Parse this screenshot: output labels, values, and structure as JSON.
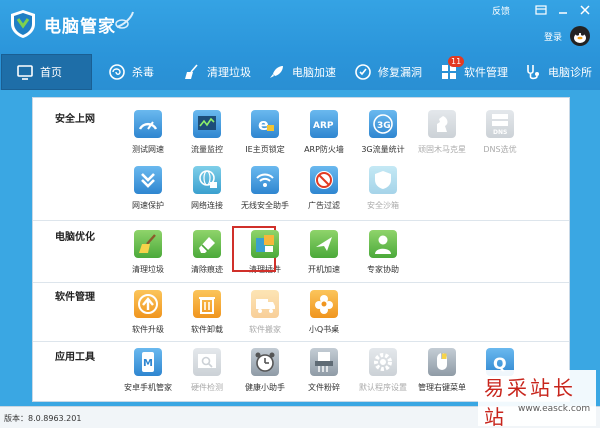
{
  "window": {
    "title": "电脑管家",
    "feedback": "反馈",
    "login": "登录"
  },
  "nav": [
    {
      "label": "首页",
      "icon": "monitor-icon",
      "active": true
    },
    {
      "label": "杀毒",
      "icon": "shield-swirl-icon"
    },
    {
      "label": "清理垃圾",
      "icon": "broom-icon"
    },
    {
      "label": "电脑加速",
      "icon": "rocket-icon"
    },
    {
      "label": "修复漏洞",
      "icon": "patch-icon"
    },
    {
      "label": "软件管理",
      "icon": "app-grid-icon",
      "badge": "11"
    },
    {
      "label": "电脑诊所",
      "icon": "stethoscope-icon"
    }
  ],
  "sections": {
    "security": {
      "title": "安全上网",
      "tools": [
        {
          "label": "测试网速",
          "icon": "speed-test-icon"
        },
        {
          "label": "流量监控",
          "icon": "traffic-monitor-icon"
        },
        {
          "label": "IE主页锁定",
          "icon": "ie-lock-icon"
        },
        {
          "label": "ARP防火墙",
          "icon": "arp-firewall-icon",
          "text": "ARP"
        },
        {
          "label": "3G流量统计",
          "icon": "3g-stats-icon",
          "text": "3G"
        },
        {
          "label": "顽固木马克星",
          "icon": "trojan-killer-icon"
        },
        {
          "label": "DNS选优",
          "icon": "dns-icon",
          "text": "DNS"
        },
        {
          "label": "网速保护",
          "icon": "speed-protect-icon"
        },
        {
          "label": "网络连接",
          "icon": "network-connect-icon"
        },
        {
          "label": "无线安全助手",
          "icon": "wifi-icon"
        },
        {
          "label": "广告过滤",
          "icon": "ad-filter-icon"
        },
        {
          "label": "安全沙箱",
          "icon": "sandbox-icon"
        }
      ]
    },
    "optimize": {
      "title": "电脑优化",
      "tools": [
        {
          "label": "清理垃圾",
          "icon": "broom-icon"
        },
        {
          "label": "清除痕迹",
          "icon": "eraser-icon"
        },
        {
          "label": "清理插件",
          "icon": "plugin-clean-icon"
        },
        {
          "label": "开机加速",
          "icon": "boot-speed-icon"
        },
        {
          "label": "专家协助",
          "icon": "expert-icon"
        }
      ]
    },
    "software": {
      "title": "软件管理",
      "tools": [
        {
          "label": "软件升级",
          "icon": "upgrade-icon"
        },
        {
          "label": "软件卸载",
          "icon": "uninstall-icon"
        },
        {
          "label": "软件搬家",
          "icon": "move-software-icon"
        },
        {
          "label": "小Q书桌",
          "icon": "q-desk-icon"
        }
      ]
    },
    "apps": {
      "title": "应用工具",
      "tools": [
        {
          "label": "安卓手机管家",
          "icon": "android-manager-icon",
          "text": "M"
        },
        {
          "label": "硬件检测",
          "icon": "hardware-check-icon"
        },
        {
          "label": "健康小助手",
          "icon": "alarm-clock-icon"
        },
        {
          "label": "文件粉碎",
          "icon": "shredder-icon"
        },
        {
          "label": "默认程序设置",
          "icon": "gear-icon"
        },
        {
          "label": "管理右键菜单",
          "icon": "mouse-icon"
        },
        {
          "label": "Q",
          "icon": "q-icon",
          "text": "Q"
        }
      ]
    }
  },
  "status": {
    "version": "版本：8.0.8963.201"
  },
  "watermark": {
    "text": "易采站长站",
    "url": "www.easck.com"
  }
}
